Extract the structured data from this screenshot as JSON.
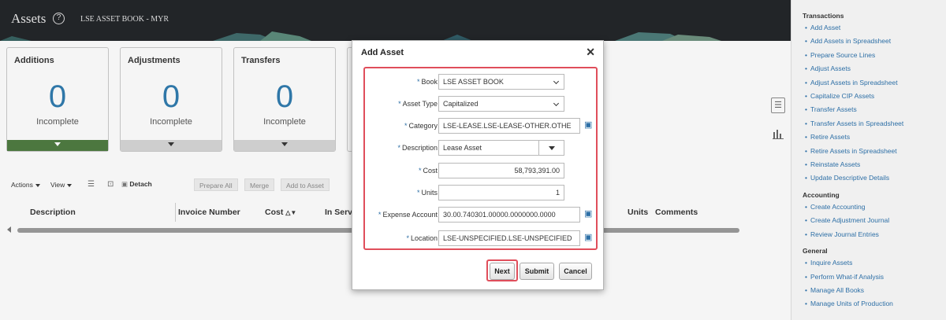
{
  "header": {
    "app_title": "Assets",
    "help_icon": "help-circle-icon",
    "book_title": "LSE ASSET BOOK - MYR"
  },
  "tiles": [
    {
      "title": "Additions",
      "count": "0",
      "status": "Incomplete",
      "active": true
    },
    {
      "title": "Adjustments",
      "count": "0",
      "status": "Incomplete",
      "active": false
    },
    {
      "title": "Transfers",
      "count": "0",
      "status": "Incomplete",
      "active": false
    }
  ],
  "toolbar": {
    "actions": "Actions",
    "view": "View",
    "detach": "Detach",
    "prepare_all": "Prepare All",
    "merge": "Merge",
    "add_to_asset": "Add to Asset"
  },
  "table": {
    "columns": [
      "Description",
      "Invoice Number",
      "Cost",
      "In Serv",
      "Units",
      "Comments"
    ]
  },
  "dialog": {
    "title": "Add Asset",
    "fields": {
      "book": {
        "label": "Book",
        "value": "LSE ASSET BOOK"
      },
      "asset_type": {
        "label": "Asset Type",
        "value": "Capitalized"
      },
      "category": {
        "label": "Category",
        "value": "LSE-LEASE.LSE-LEASE-OTHER.OTHE"
      },
      "description": {
        "label": "Description",
        "value": "Lease Asset"
      },
      "cost": {
        "label": "Cost",
        "value": "58,793,391.00"
      },
      "units": {
        "label": "Units",
        "value": "1"
      },
      "expense_account": {
        "label": "Expense Account",
        "value": "30.00.740301.00000.0000000.0000"
      },
      "location": {
        "label": "Location",
        "value": "LSE-UNSPECIFIED.LSE-UNSPECIFIED"
      }
    },
    "buttons": {
      "next": "Next",
      "submit": "Submit",
      "cancel": "Cancel"
    }
  },
  "right_panel": {
    "sections": [
      {
        "heading": "Transactions",
        "items": [
          "Add Asset",
          "Add Assets in Spreadsheet",
          "Prepare Source Lines",
          "Adjust Assets",
          "Adjust Assets in Spreadsheet",
          "Capitalize CIP Assets",
          "Transfer Assets",
          "Transfer Assets in Spreadsheet",
          "Retire Assets",
          "Retire Assets in Spreadsheet",
          "Reinstate Assets",
          "Update Descriptive Details"
        ]
      },
      {
        "heading": "Accounting",
        "items": [
          "Create Accounting",
          "Create Adjustment Journal",
          "Review Journal Entries"
        ]
      },
      {
        "heading": "General",
        "items": [
          "Inquire Assets",
          "Perform What-if Analysis",
          "Manage All Books",
          "Manage Units of Production"
        ]
      }
    ]
  },
  "colors": {
    "accent_blue": "#2d7aae",
    "link_blue": "#2d6fa6",
    "highlight_red": "#e04e5b",
    "active_tile_green": "#4c7a3e",
    "banner_dark": "#1f2226"
  }
}
